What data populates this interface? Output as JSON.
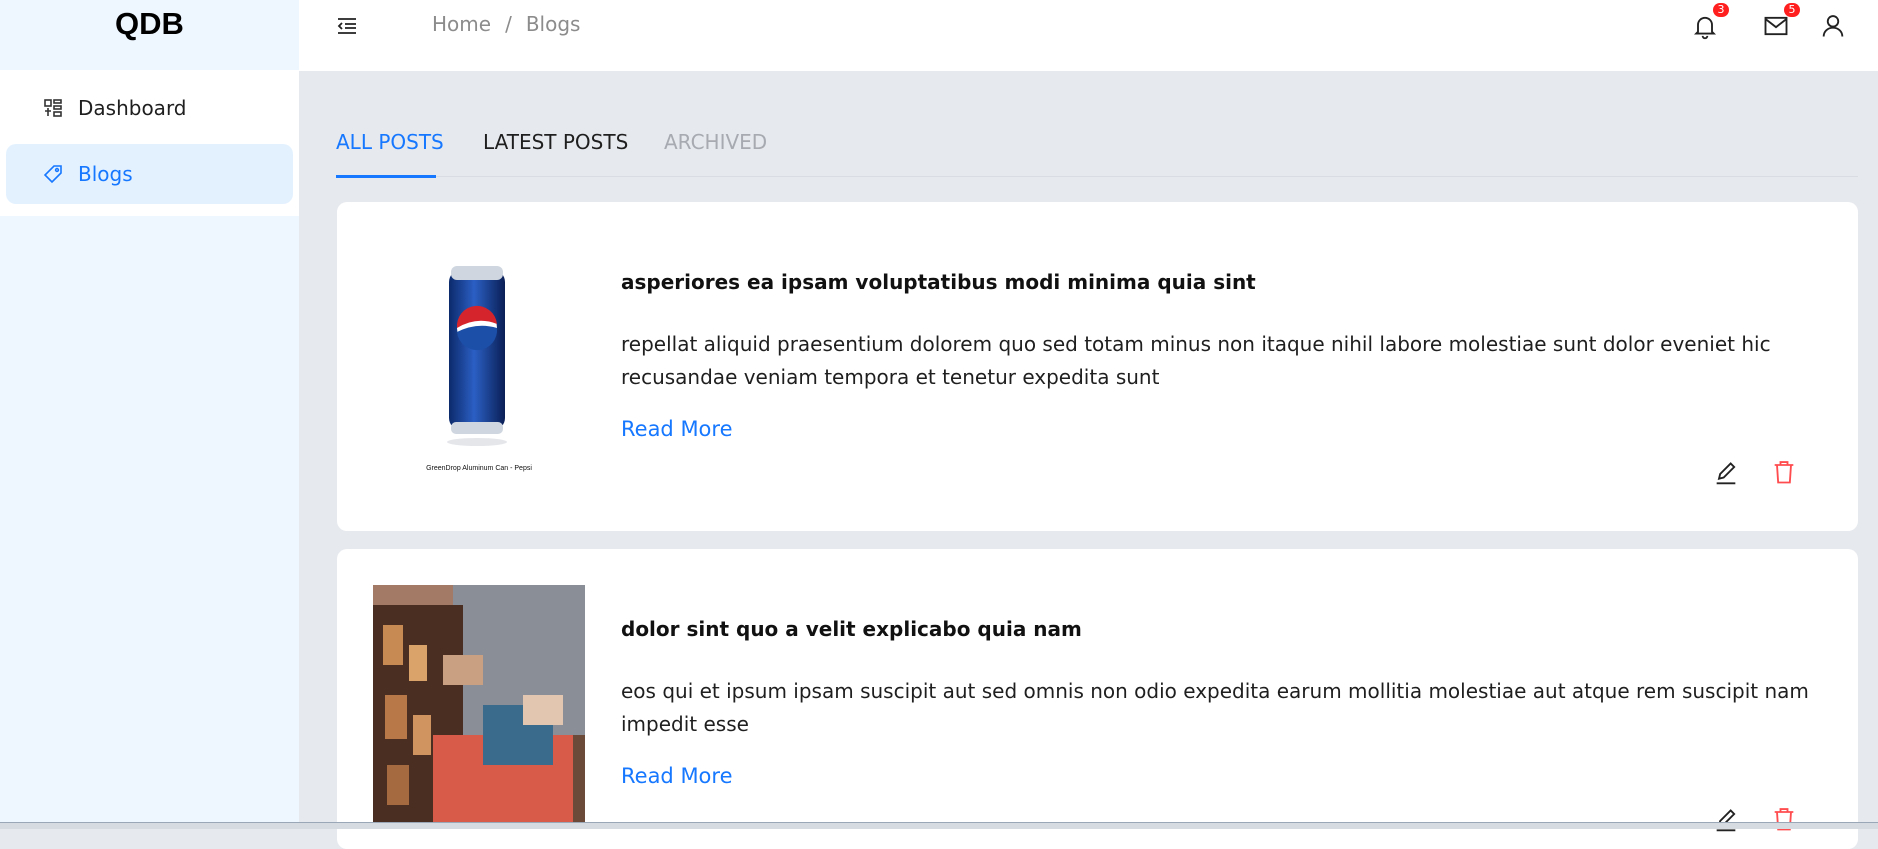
{
  "app": {
    "logo": "QDB"
  },
  "sidebar": {
    "items": [
      {
        "label": "Dashboard",
        "icon": "dashboard-icon",
        "active": false
      },
      {
        "label": "Blogs",
        "icon": "tag-icon",
        "active": true
      }
    ]
  },
  "header": {
    "breadcrumb": {
      "home": "Home",
      "separator": "/",
      "current": "Blogs"
    },
    "notifications_count": "3",
    "messages_count": "5"
  },
  "tabs": [
    {
      "label": "ALL POSTS",
      "state": "active"
    },
    {
      "label": "LATEST POSTS",
      "state": "normal"
    },
    {
      "label": "ARCHIVED",
      "state": "disabled"
    }
  ],
  "posts": [
    {
      "title": "asperiores ea ipsam voluptatibus modi minima quia sint",
      "body": "repellat aliquid praesentium dolorem quo sed totam minus non itaque nihil labore molestiae sunt dolor eveniet hic recusandae veniam tempora et tenetur expedita sunt",
      "read_more": "Read More",
      "image_caption": "GreenDrop Aluminum Can - Pepsi",
      "image_text": "pepsi"
    },
    {
      "title": "dolor sint quo a velit explicabo quia nam",
      "body": "eos qui et ipsum ipsam suscipit aut sed omnis non odio expedita earum mollitia molestiae aut atque rem suscipit nam impedit esse",
      "read_more": "Read More"
    }
  ],
  "colors": {
    "accent": "#1677ff",
    "danger": "#ff4d4f",
    "sidebar_bg": "#eef6ff",
    "content_bg": "#e6e9ee"
  }
}
